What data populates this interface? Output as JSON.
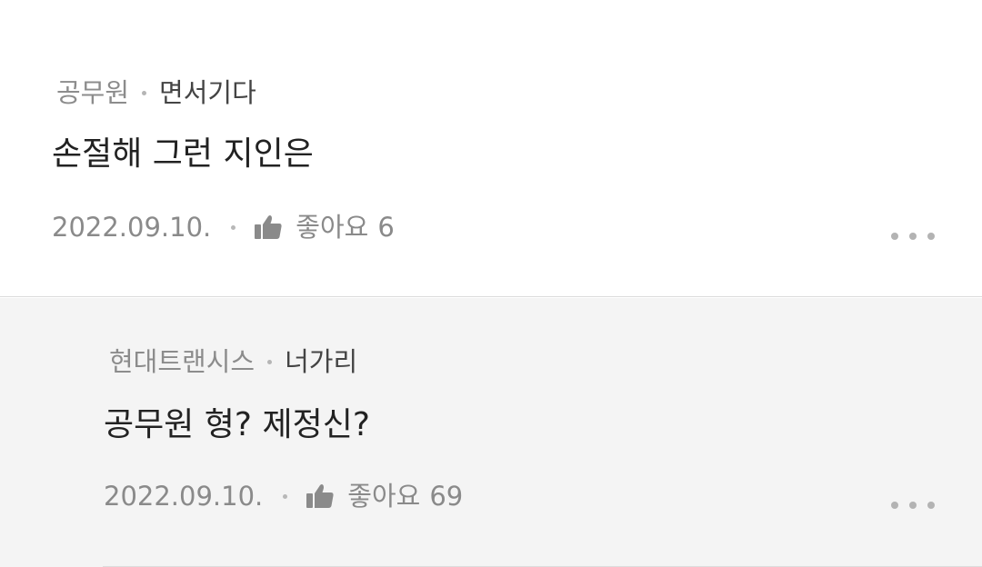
{
  "comments": [
    {
      "company": "공무원",
      "nickname": "면서기다",
      "text": "손절해 그런 지인은",
      "date": "2022.09.10.",
      "like_label": "좋아요",
      "like_count": "6",
      "like_icon": "thumbs-up-icon",
      "more_icon": "more-horizontal-icon"
    },
    {
      "company": "현대트랜시스",
      "nickname": "너가리",
      "text": "공무원 형? 제정신?",
      "date": "2022.09.10.",
      "like_label": "좋아요",
      "like_count": "69",
      "like_icon": "thumbs-up-icon",
      "more_icon": "more-horizontal-icon"
    }
  ],
  "colors": {
    "reply_background": "#f4f4f4",
    "meta_gray": "#8a8a8a",
    "body_text": "#222222"
  }
}
